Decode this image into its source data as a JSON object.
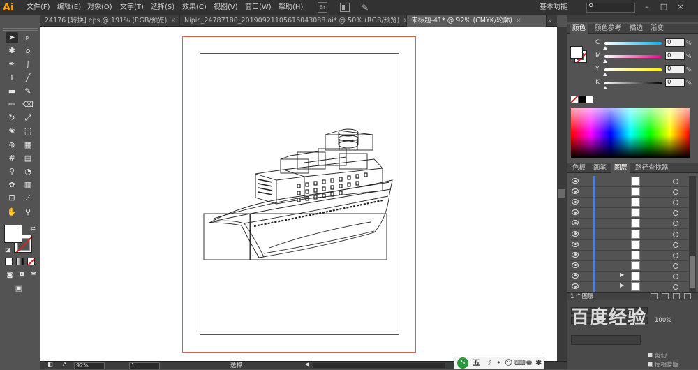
{
  "app": {
    "logo": "Ai"
  },
  "menus": [
    "文件(F)",
    "编辑(E)",
    "对象(O)",
    "文字(T)",
    "选择(S)",
    "效果(C)",
    "视图(V)",
    "窗口(W)",
    "帮助(H)"
  ],
  "menubar_icons": {
    "bridge": "Br",
    "arrange": "arrange-documents-icon",
    "gpu": "gpu-performance-icon"
  },
  "workspace": {
    "label": "基本功能",
    "search_icon": "search-icon"
  },
  "window_buttons": [
    "–",
    "□",
    "×"
  ],
  "tabs": [
    {
      "label": "24176 [转换].eps @ 191% (RGB/预览)",
      "active": false
    },
    {
      "label": "Nipic_24787180_20190921105616043088.ai* @ 50% (RGB/预览)",
      "active": false
    },
    {
      "label": "未标题-41* @ 92% (CMYK/轮廓)",
      "active": true
    }
  ],
  "tab_close": "×",
  "tab_overflow": "»",
  "tools": [
    {
      "name": "selection-tool",
      "glyph": "➤"
    },
    {
      "name": "direct-selection-tool",
      "glyph": "▹"
    },
    {
      "name": "magic-wand-tool",
      "glyph": "✱"
    },
    {
      "name": "lasso-tool",
      "glyph": "ϱ"
    },
    {
      "name": "pen-tool",
      "glyph": "✒"
    },
    {
      "name": "curvature-tool",
      "glyph": "∫"
    },
    {
      "name": "type-tool",
      "glyph": "T"
    },
    {
      "name": "line-tool",
      "glyph": "╱"
    },
    {
      "name": "rectangle-tool",
      "glyph": "▬"
    },
    {
      "name": "paintbrush-tool",
      "glyph": "✎"
    },
    {
      "name": "pencil-tool",
      "glyph": "✏"
    },
    {
      "name": "eraser-tool",
      "glyph": "⌫"
    },
    {
      "name": "rotate-tool",
      "glyph": "↻"
    },
    {
      "name": "scale-tool",
      "glyph": "⤢"
    },
    {
      "name": "warp-tool",
      "glyph": "❀"
    },
    {
      "name": "free-transform-tool",
      "glyph": "⬚"
    },
    {
      "name": "shape-builder-tool",
      "glyph": "⊕"
    },
    {
      "name": "perspective-grid-tool",
      "glyph": "▦"
    },
    {
      "name": "mesh-tool",
      "glyph": "#"
    },
    {
      "name": "gradient-tool",
      "glyph": "▤"
    },
    {
      "name": "eyedropper-tool",
      "glyph": "⚲"
    },
    {
      "name": "blend-tool",
      "glyph": "◔"
    },
    {
      "name": "symbol-sprayer-tool",
      "glyph": "✿"
    },
    {
      "name": "column-graph-tool",
      "glyph": "▥"
    },
    {
      "name": "artboard-tool",
      "glyph": "⊡"
    },
    {
      "name": "slice-tool",
      "glyph": "⟋"
    },
    {
      "name": "hand-tool",
      "glyph": "✋"
    },
    {
      "name": "zoom-tool",
      "glyph": "⚲"
    }
  ],
  "color_panel": {
    "tabs": [
      "颜色",
      "颜色参考",
      "描边",
      "渐变"
    ],
    "sliders": [
      {
        "label": "C",
        "value": "0",
        "color": "#00aeef"
      },
      {
        "label": "M",
        "value": "0",
        "color": "#ec008c"
      },
      {
        "label": "Y",
        "value": "0",
        "color": "#fff200"
      },
      {
        "label": "K",
        "value": "0",
        "color": "#000000"
      }
    ],
    "unit": "%"
  },
  "layers_panel": {
    "tabs": [
      "色板",
      "画笔",
      "图层",
      "路径查找器"
    ],
    "row_count": 11,
    "expandable_rows": [
      9,
      10
    ],
    "footer_label": "1 个图层"
  },
  "lower_panel": {
    "percent": "100%",
    "cut_label": "剪切",
    "reverse_label": "反相蒙版"
  },
  "status": {
    "zoom": "92%",
    "artboard": "1",
    "label": "选择"
  },
  "ime": {
    "label": "五"
  },
  "watermark": "百度经验"
}
